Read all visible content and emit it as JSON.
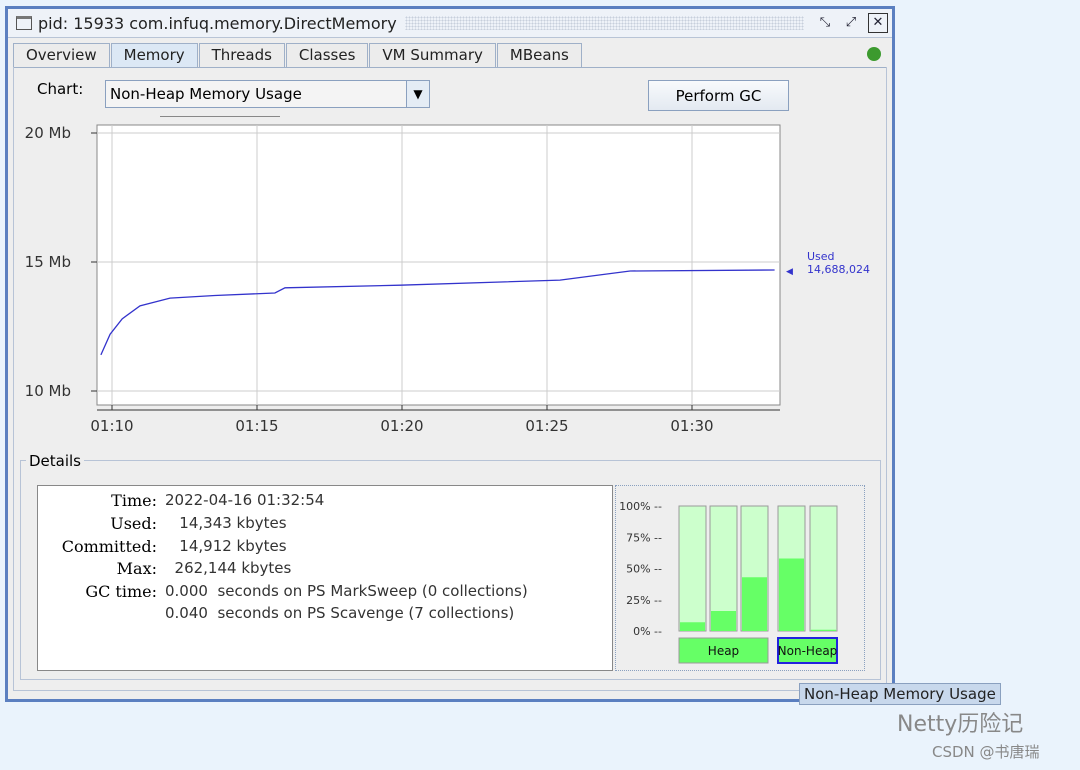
{
  "window": {
    "title": "pid: 15933 com.infuq.memory.DirectMemory"
  },
  "tabs": [
    "Overview",
    "Memory",
    "Threads",
    "Classes",
    "VM Summary",
    "MBeans"
  ],
  "active_tab": "Memory",
  "controls": {
    "chart_label": "Chart:",
    "chart_selected": "Non-Heap Memory Usage",
    "gc_button": "Perform GC"
  },
  "chart_data": {
    "type": "line",
    "ylim": [
      10,
      20
    ],
    "yticks": [
      "10 Mb",
      "15 Mb",
      "20 Mb"
    ],
    "xticks": [
      "01:10",
      "01:15",
      "01:20",
      "01:25",
      "01:30"
    ],
    "grid": true,
    "series": [
      {
        "name": "Used",
        "color": "#3333cc",
        "x": [
          "01:09:37",
          "01:09:56",
          "01:10:21",
          "01:10:58",
          "01:12:00",
          "01:13:33",
          "01:15:37",
          "01:15:58",
          "01:19:56",
          "01:25:27",
          "01:26:50",
          "01:27:52",
          "01:32:51"
        ],
        "y": [
          11.4,
          12.2,
          12.8,
          13.3,
          13.6,
          13.7,
          13.8,
          14.0,
          14.1,
          14.3,
          14.5,
          14.65,
          14.69
        ]
      }
    ],
    "current_label": "Used",
    "current_value": "14,688,024"
  },
  "details": {
    "title": "Details",
    "rows": [
      {
        "k": "Time:",
        "v": "2022-04-16 01:32:54"
      },
      {
        "k": "Used:",
        "v": "   14,343 kbytes"
      },
      {
        "k": "Committed:",
        "v": "   14,912 kbytes"
      },
      {
        "k": "Max:",
        "v": "  262,144 kbytes"
      },
      {
        "k": "GC time:",
        "v": "0.000  seconds on PS MarkSweep (0 collections)"
      },
      {
        "k": "",
        "v": "0.040  seconds on PS Scavenge (7 collections)"
      }
    ]
  },
  "pool_bars": {
    "ticks": [
      "100%",
      "75%",
      "50%",
      "25%",
      "0%"
    ],
    "fills": [
      7,
      16,
      43,
      58,
      1
    ],
    "groups": [
      "Heap",
      "Non-Heap"
    ],
    "selected": "Non-Heap",
    "fill_color": "#66ff66",
    "bg_color": "#ccffcc"
  },
  "tooltip": "Non-Heap Memory Usage",
  "watermark": {
    "line1": "Netty历险记",
    "line2": "CSDN @书唐瑞"
  }
}
